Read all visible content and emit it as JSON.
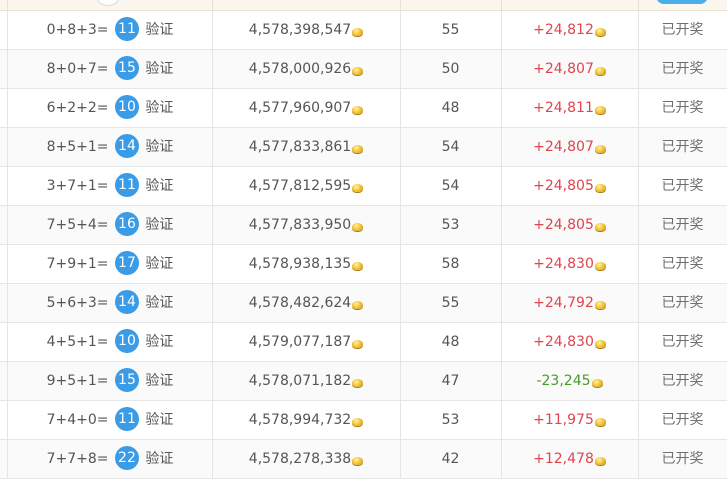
{
  "verify_label": "验证",
  "status_label": "已开奖",
  "colors": {
    "ball": "#3a9be6",
    "profit_positive": "#e0444d",
    "profit_negative": "#4b9a2d"
  },
  "rows": [
    {
      "expression": "0+8+3=",
      "result": "11",
      "total": "4,578,398,547",
      "count": "55",
      "profit": "+24,812",
      "profit_sign": "positive"
    },
    {
      "expression": "8+0+7=",
      "result": "15",
      "total": "4,578,000,926",
      "count": "50",
      "profit": "+24,807",
      "profit_sign": "positive"
    },
    {
      "expression": "6+2+2=",
      "result": "10",
      "total": "4,577,960,907",
      "count": "48",
      "profit": "+24,811",
      "profit_sign": "positive"
    },
    {
      "expression": "8+5+1=",
      "result": "14",
      "total": "4,577,833,861",
      "count": "54",
      "profit": "+24,807",
      "profit_sign": "positive"
    },
    {
      "expression": "3+7+1=",
      "result": "11",
      "total": "4,577,812,595",
      "count": "54",
      "profit": "+24,805",
      "profit_sign": "positive"
    },
    {
      "expression": "7+5+4=",
      "result": "16",
      "total": "4,577,833,950",
      "count": "53",
      "profit": "+24,805",
      "profit_sign": "positive"
    },
    {
      "expression": "7+9+1=",
      "result": "17",
      "total": "4,578,938,135",
      "count": "58",
      "profit": "+24,830",
      "profit_sign": "positive"
    },
    {
      "expression": "5+6+3=",
      "result": "14",
      "total": "4,578,482,624",
      "count": "55",
      "profit": "+24,792",
      "profit_sign": "positive"
    },
    {
      "expression": "4+5+1=",
      "result": "10",
      "total": "4,579,077,187",
      "count": "48",
      "profit": "+24,830",
      "profit_sign": "positive"
    },
    {
      "expression": "9+5+1=",
      "result": "15",
      "total": "4,578,071,182",
      "count": "47",
      "profit": "-23,245",
      "profit_sign": "negative"
    },
    {
      "expression": "7+4+0=",
      "result": "11",
      "total": "4,578,994,732",
      "count": "53",
      "profit": "+11,975",
      "profit_sign": "positive"
    },
    {
      "expression": "7+7+8=",
      "result": "22",
      "total": "4,578,278,338",
      "count": "42",
      "profit": "+12,478",
      "profit_sign": "positive"
    }
  ]
}
